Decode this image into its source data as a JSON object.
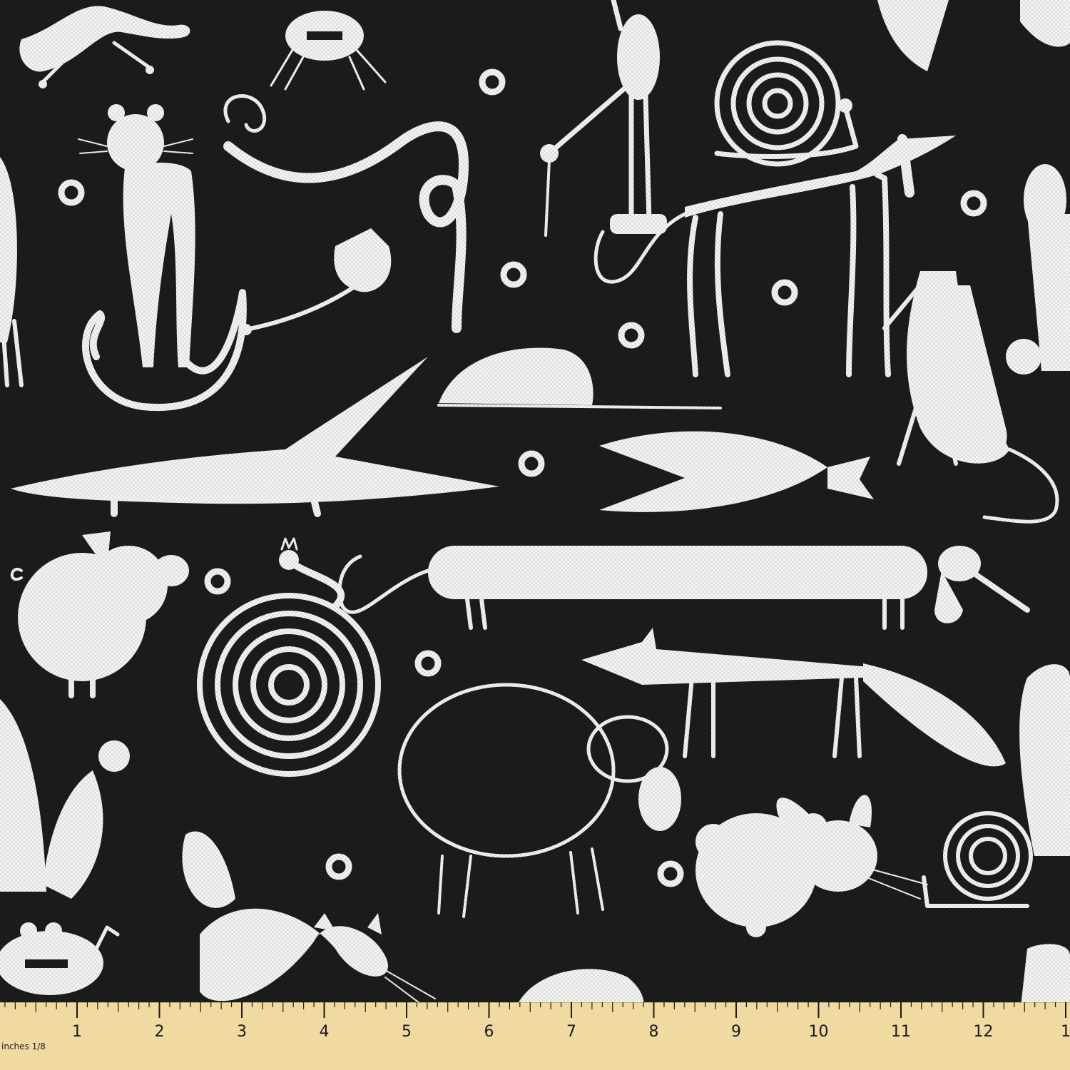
{
  "fabric": {
    "background_color": "#1c1c1c",
    "motif_color": "#f4f4f2",
    "motifs": [
      "lizard-icon",
      "crab-icon",
      "cat-icon",
      "heron-icon",
      "snail-icon",
      "dog-icon",
      "rabbit-icon",
      "mouse-icon",
      "crocodile-icon",
      "fish-icon",
      "pig-icon",
      "snake-icon",
      "dachshund-icon",
      "fox-icon",
      "sheep-icon",
      "hamster-icon"
    ]
  },
  "ruler": {
    "background_color": "#f1d9a2",
    "units_label": "inches 1/8",
    "tick_labels": [
      "1",
      "2",
      "3",
      "4",
      "5",
      "6",
      "7",
      "8",
      "9",
      "10",
      "11",
      "12",
      "1"
    ]
  }
}
